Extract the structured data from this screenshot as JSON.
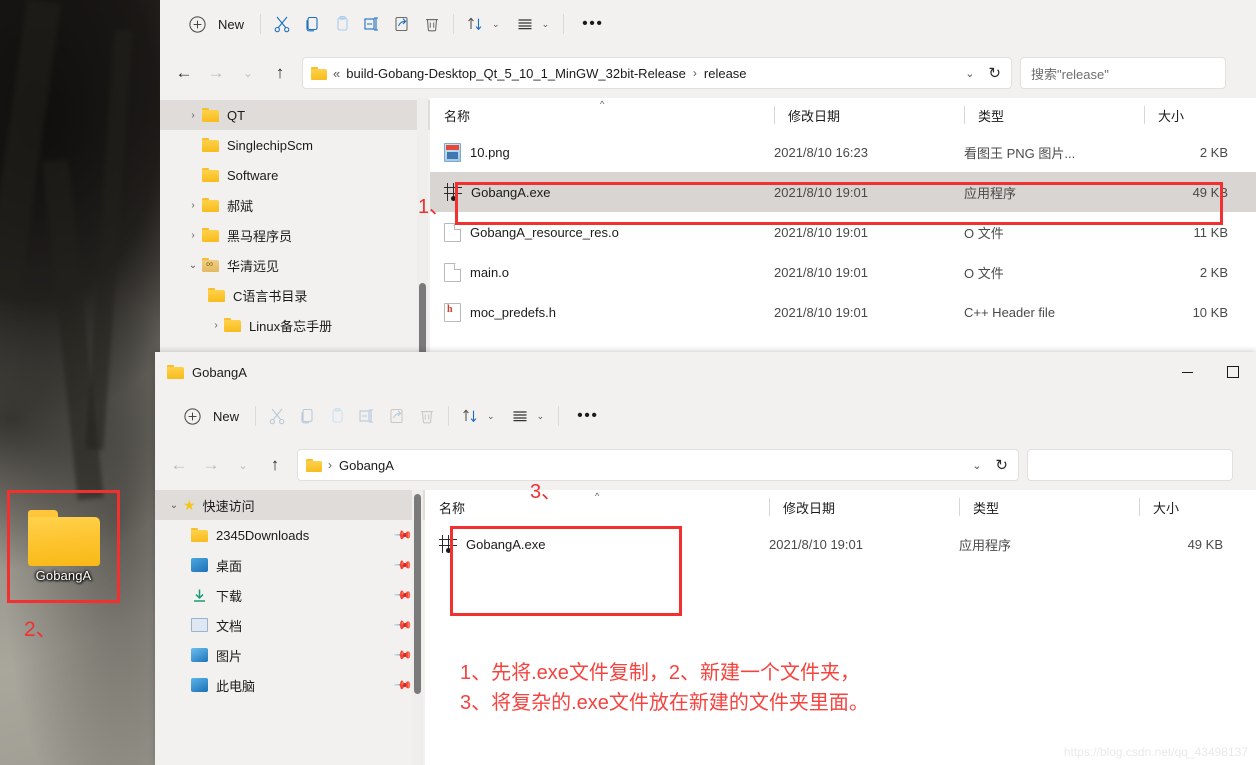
{
  "desktop": {
    "icon": {
      "label": "GobangA",
      "icon": "folder-icon"
    },
    "marker": "2、"
  },
  "watermark": "https://blog.csdn.net/qq_43498137",
  "annotation": "1、先将.exe文件复制，2、新建一个文件夹，\n3、将复杂的.exe文件放在新建的文件夹里面。",
  "window_top": {
    "toolbar": {
      "new_label": "New",
      "icons": [
        "scissors-icon",
        "copy-icon",
        "paste-icon",
        "rename-icon",
        "share-icon",
        "delete-icon",
        "sort-icon",
        "view-icon",
        "more-icon"
      ]
    },
    "address": {
      "overflow": "«",
      "crumb1": "build-Gobang-Desktop_Qt_5_10_1_MinGW_32bit-Release",
      "crumb2": "release",
      "chevron": "⌄",
      "refresh": "↻"
    },
    "search": {
      "placeholder": "搜索\"release\""
    },
    "nav": [
      {
        "label": "QT",
        "twisty": "›",
        "selected": true,
        "icon": "folder-icon"
      },
      {
        "label": "SinglechipScm",
        "twisty": "",
        "selected": false,
        "icon": "folder-icon"
      },
      {
        "label": "Software",
        "twisty": "",
        "selected": false,
        "icon": "folder-icon"
      },
      {
        "label": "郝斌",
        "twisty": "›",
        "selected": false,
        "icon": "folder-icon"
      },
      {
        "label": "黑马程序员",
        "twisty": "›",
        "selected": false,
        "icon": "folder-icon"
      },
      {
        "label": "华清远见",
        "twisty": "⌄",
        "selected": false,
        "icon": "folder-special-icon"
      },
      {
        "label": "C语言书目录",
        "twisty": "",
        "selected": false,
        "icon": "folder-icon"
      },
      {
        "label": "Linux备忘手册",
        "twisty": "›",
        "selected": false,
        "icon": "folder-icon"
      }
    ],
    "columns": [
      "名称",
      "修改日期",
      "类型",
      "大小"
    ],
    "files": [
      {
        "name": "10.png",
        "icon": "png-file-icon",
        "date": "2021/8/10 16:23",
        "type": "看图王 PNG 图片...",
        "size": "2 KB",
        "selected": false
      },
      {
        "name": "GobangA.exe",
        "icon": "exe-file-icon",
        "date": "2021/8/10 19:01",
        "type": "应用程序",
        "size": "49 KB",
        "selected": true
      },
      {
        "name": "GobangA_resource_res.o",
        "icon": "generic-file-icon",
        "date": "2021/8/10 19:01",
        "type": "O 文件",
        "size": "11 KB",
        "selected": false
      },
      {
        "name": "main.o",
        "icon": "generic-file-icon",
        "date": "2021/8/10 19:01",
        "type": "O 文件",
        "size": "2 KB",
        "selected": false
      },
      {
        "name": "moc_predefs.h",
        "icon": "h-file-icon",
        "date": "2021/8/10 19:01",
        "type": "C++ Header file",
        "size": "10 KB",
        "selected": false
      }
    ],
    "marker": "1、"
  },
  "window_bottom": {
    "title": "GobangA",
    "controls": {
      "minimize": "—",
      "maximize": "▢"
    },
    "toolbar": {
      "new_label": "New",
      "icons": [
        "scissors-icon",
        "copy-icon",
        "paste-icon",
        "rename-icon",
        "share-icon",
        "delete-icon",
        "sort-icon",
        "view-icon",
        "more-icon"
      ]
    },
    "address": {
      "crumb1": "GobangA",
      "chevron": "⌄",
      "refresh": "↻"
    },
    "search": {
      "placeholder": ""
    },
    "nav_header": {
      "label": "快速访问",
      "twisty": "⌄",
      "icon": "star-icon"
    },
    "nav": [
      {
        "label": "2345Downloads",
        "icon": "folder-icon",
        "pinned": true
      },
      {
        "label": "桌面",
        "icon": "desktop-icon",
        "pinned": true
      },
      {
        "label": "下载",
        "icon": "downloads-icon",
        "pinned": true
      },
      {
        "label": "文档",
        "icon": "documents-icon",
        "pinned": true
      },
      {
        "label": "图片",
        "icon": "pictures-icon",
        "pinned": true
      },
      {
        "label": "此电脑",
        "icon": "this-pc-icon",
        "pinned": true
      }
    ],
    "columns": [
      "名称",
      "修改日期",
      "类型",
      "大小"
    ],
    "files": [
      {
        "name": "GobangA.exe",
        "icon": "exe-file-icon",
        "date": "2021/8/10 19:01",
        "type": "应用程序",
        "size": "49 KB",
        "selected": false
      }
    ],
    "marker": "3、"
  },
  "colors": {
    "accent_red": "#f23030",
    "note_red": "#f5433f",
    "folder_yellow": "#f7bb1b"
  }
}
